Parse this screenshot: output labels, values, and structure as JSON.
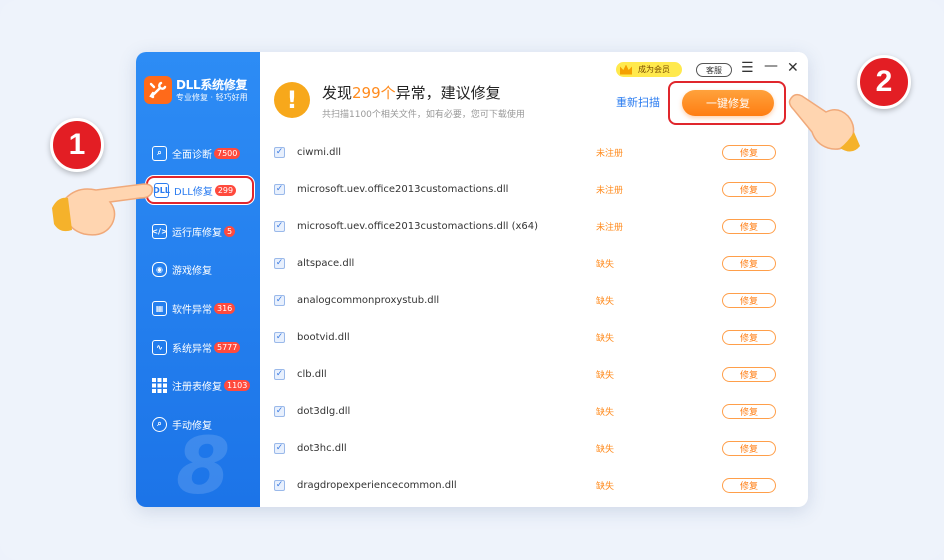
{
  "app": {
    "title": "DLL系统修复",
    "subtitle": "专业修复 · 轻巧好用"
  },
  "sidebar": {
    "items": [
      {
        "label": "全面诊断",
        "badge": "7500",
        "icon": "scan-icon"
      },
      {
        "label": "DLL修复",
        "badge": "299",
        "icon": "dll-icon",
        "active": true
      },
      {
        "label": "运行库修复",
        "badge": "5",
        "icon": "code-icon"
      },
      {
        "label": "游戏修复",
        "badge": "",
        "icon": "gamepad-icon"
      },
      {
        "label": "软件异常",
        "badge": "316",
        "icon": "software-icon"
      },
      {
        "label": "系统异常",
        "badge": "5777",
        "icon": "monitor-icon"
      },
      {
        "label": "注册表修复",
        "badge": "1103",
        "icon": "grid-icon"
      },
      {
        "label": "手动修复",
        "badge": "",
        "icon": "search-icon"
      }
    ],
    "watermark": "8"
  },
  "header": {
    "headline_prefix": "发现",
    "headline_count": "299个",
    "headline_suffix": "异常，建议修复",
    "subline": "共扫描1100个相关文件，如有必要，您可下载使用",
    "rescan": "重新扫描",
    "fix_all": "一键修复",
    "vip": "成为会员",
    "service": "客服"
  },
  "files": [
    {
      "name": "ciwmi.dll",
      "status": "未注册",
      "action": "修复"
    },
    {
      "name": "microsoft.uev.office2013customactions.dll",
      "status": "未注册",
      "action": "修复"
    },
    {
      "name": "microsoft.uev.office2013customactions.dll (x64)",
      "status": "未注册",
      "action": "修复"
    },
    {
      "name": "altspace.dll",
      "status": "缺失",
      "action": "修复"
    },
    {
      "name": "analogcommonproxystub.dll",
      "status": "缺失",
      "action": "修复"
    },
    {
      "name": "bootvid.dll",
      "status": "缺失",
      "action": "修复"
    },
    {
      "name": "clb.dll",
      "status": "缺失",
      "action": "修复"
    },
    {
      "name": "dot3dlg.dll",
      "status": "缺失",
      "action": "修复"
    },
    {
      "name": "dot3hc.dll",
      "status": "缺失",
      "action": "修复"
    },
    {
      "name": "dragdropexperiencecommon.dll",
      "status": "缺失",
      "action": "修复"
    }
  ],
  "callouts": {
    "step1": "1",
    "step2": "2"
  },
  "colors": {
    "accent": "#2b7cf0",
    "warning": "#ff8b1e",
    "highlight": "#e0262c"
  }
}
